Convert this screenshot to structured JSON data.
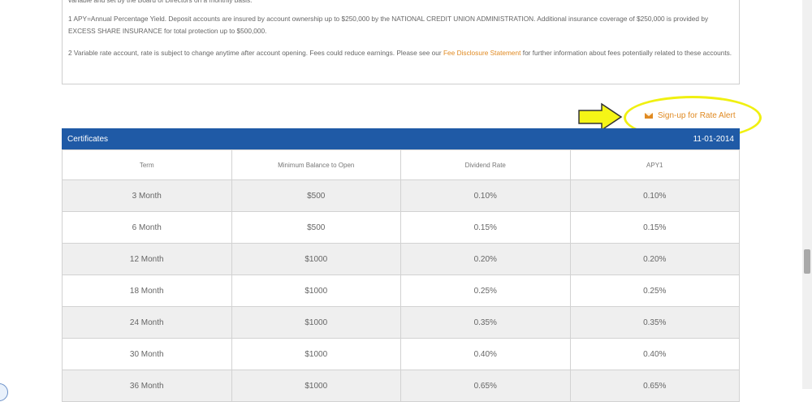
{
  "notes": {
    "top_line": "variable and set by the Board of Directors on a monthly basis.",
    "note1": "1 APY=Annual Percentage Yield. Deposit accounts are insured by account ownership up to $250,000 by the NATIONAL CREDIT UNION ADMINISTRATION. Additional insurance coverage of $250,000 is provided by EXCESS SHARE INSURANCE for total protection up to $500,000.",
    "note2_before": "2 Variable rate account, rate is subject to change anytime after account opening. Fees could reduce earnings. Please see our ",
    "note2_link": "Fee Disclosure Statement",
    "note2_after": " for further information about fees potentially related to these accounts."
  },
  "rate_alert": {
    "icon": "envelope-icon",
    "label": "Sign-up for Rate Alert"
  },
  "certificates": {
    "title": "Certificates",
    "date": "11-01-2014",
    "columns": [
      "Term",
      "Minimum Balance to Open",
      "Dividend Rate",
      "APY1"
    ],
    "rows": [
      [
        "3 Month",
        "$500",
        "0.10%",
        "0.10%"
      ],
      [
        "6 Month",
        "$500",
        "0.15%",
        "0.15%"
      ],
      [
        "12 Month",
        "$1000",
        "0.20%",
        "0.20%"
      ],
      [
        "18 Month",
        "$1000",
        "0.25%",
        "0.25%"
      ],
      [
        "24 Month",
        "$1000",
        "0.35%",
        "0.35%"
      ],
      [
        "30 Month",
        "$1000",
        "0.40%",
        "0.40%"
      ],
      [
        "36 Month",
        "$1000",
        "0.65%",
        "0.65%"
      ]
    ]
  },
  "colors": {
    "header_blue": "#1f5aa6",
    "link_orange": "#e08a22",
    "highlight_yellow": "#f0f011"
  }
}
